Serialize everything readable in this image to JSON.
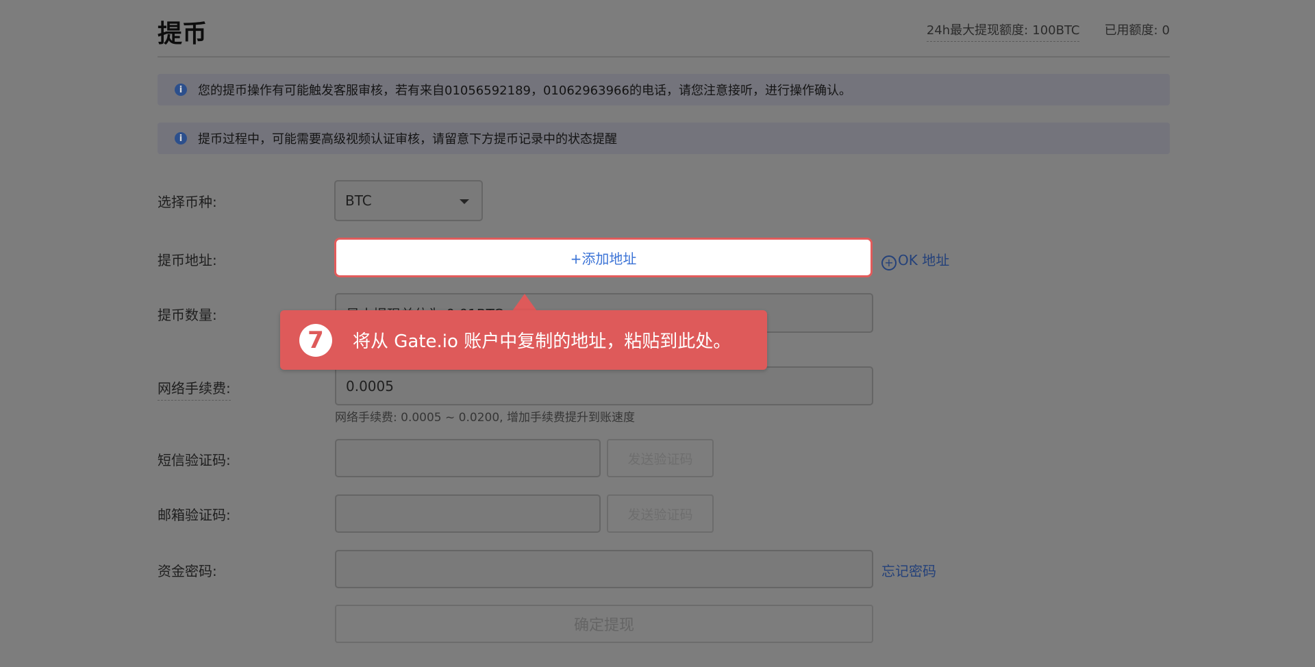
{
  "header": {
    "title": "提币",
    "limit_label": "24h最大提现额度:",
    "limit_value": "100BTC",
    "used_label": "已用额度:",
    "used_value": "0"
  },
  "notices": [
    "您的提币操作有可能触发客服审核，若有来自01056592189，01062963966的电话，请您注意接听，进行操作确认。",
    "提币过程中，可能需要高级视频认证审核，请留意下方提币记录中的状态提醒"
  ],
  "form": {
    "currency_label": "选择币种:",
    "currency_value": "BTC",
    "address_label": "提币地址:",
    "add_address_label": "+添加地址",
    "ok_address_link": "OK 地址",
    "amount_label": "提币数量:",
    "amount_placeholder": "最小提现单位为 0.01BTC",
    "fee_label": "网络手续费:",
    "fee_value": "0.0005",
    "fee_hint": "网络手续费: 0.0005 ~ 0.0200, 增加手续费提升到账速度",
    "sms_label": "短信验证码:",
    "sms_button": "发送验证码",
    "email_label": "邮箱验证码:",
    "email_button": "发送验证码",
    "password_label": "资金密码:",
    "forgot_password": "忘记密码",
    "submit_label": "确定提现"
  },
  "tooltip": {
    "step": "7",
    "text": "将从 Gate.io 账户中复制的地址，粘贴到此处。"
  },
  "colors": {
    "overlay": "#7d7d7d",
    "tooltip_bg": "#de5a5a",
    "link": "#3b73d6",
    "highlight_border": "#e25b5b"
  }
}
